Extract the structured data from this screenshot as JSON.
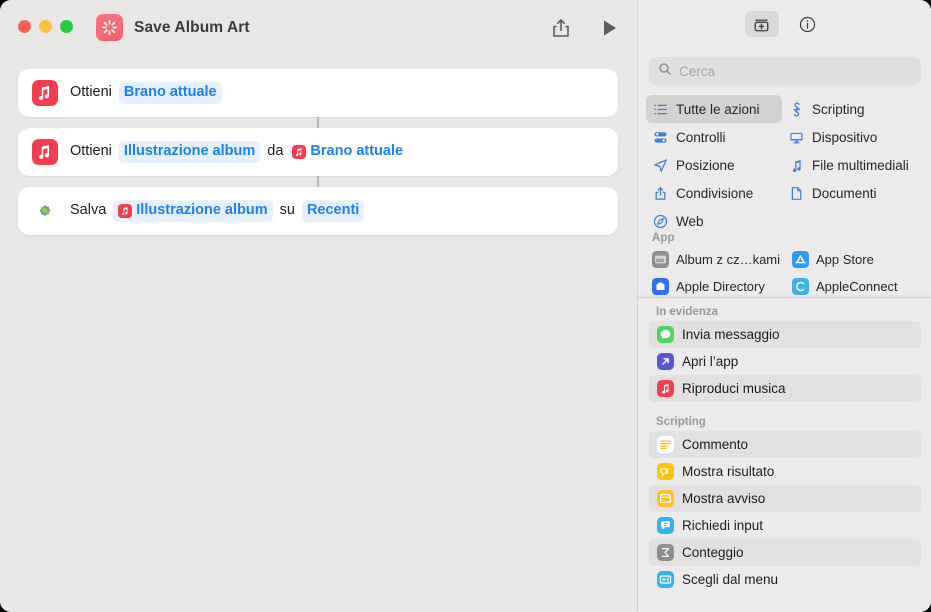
{
  "window": {
    "traffic_lights": [
      "close",
      "minimize",
      "zoom"
    ],
    "app_icon": "shortcuts-icon",
    "title": "Save Album Art",
    "share_label": "share-icon",
    "run_label": "run-icon"
  },
  "editor": {
    "actions": [
      {
        "icon": "music-app-icon",
        "icon_color": "#f43d50",
        "parts": [
          {
            "kind": "word",
            "text": "Ottieni"
          },
          {
            "kind": "token",
            "text": "Brano attuale",
            "style": "filled",
            "glyph": null
          }
        ]
      },
      {
        "icon": "music-app-icon",
        "icon_color": "#f43d50",
        "parts": [
          {
            "kind": "word",
            "text": "Ottieni"
          },
          {
            "kind": "token",
            "text": "Illustrazione album",
            "style": "filled",
            "glyph": null
          },
          {
            "kind": "word",
            "text": "da"
          },
          {
            "kind": "token",
            "text": "Brano attuale",
            "style": "plain",
            "glyph": "music-variable-icon"
          }
        ]
      },
      {
        "icon": "photos-app-icon",
        "icon_color": "#ffffff",
        "parts": [
          {
            "kind": "word",
            "text": "Salva"
          },
          {
            "kind": "token",
            "text": "Illustrazione album",
            "style": "filled",
            "glyph": "music-variable-icon"
          },
          {
            "kind": "word",
            "text": "su"
          },
          {
            "kind": "token",
            "text": "Recenti",
            "style": "filled",
            "glyph": null
          }
        ]
      }
    ]
  },
  "sidebar": {
    "toolbar": [
      {
        "name": "action-library-icon",
        "active": true
      },
      {
        "name": "info-icon",
        "active": false
      }
    ],
    "search": {
      "icon": "search-icon",
      "placeholder": "Cerca",
      "value": ""
    },
    "categories": [
      {
        "label": "Tutte le azioni",
        "icon": "list-icon",
        "selected": true
      },
      {
        "label": "Scripting",
        "icon": "scripting-icon",
        "selected": false
      },
      {
        "label": "Controlli",
        "icon": "controls-icon",
        "selected": false
      },
      {
        "label": "Dispositivo",
        "icon": "device-icon",
        "selected": false
      },
      {
        "label": "Posizione",
        "icon": "location-icon",
        "selected": false
      },
      {
        "label": "File multimediali",
        "icon": "media-icon",
        "selected": false
      },
      {
        "label": "Condivisione",
        "icon": "share-icon",
        "selected": false
      },
      {
        "label": "Documenti",
        "icon": "document-icon",
        "selected": false
      },
      {
        "label": "Web",
        "icon": "web-icon",
        "selected": false
      }
    ],
    "app_section": {
      "title": "App",
      "items": [
        {
          "label": "Album z cz…kami",
          "icon": "album-icon"
        },
        {
          "label": "App Store",
          "icon": "appstore-icon"
        },
        {
          "label": "Apple Directory",
          "icon": "apple-directory-icon"
        },
        {
          "label": "AppleConnect",
          "icon": "appleconnect-icon"
        }
      ]
    },
    "featured": {
      "title": "In evidenza",
      "items": [
        {
          "label": "Invia messaggio",
          "icon": "messages-icon",
          "color": "#4cd662",
          "striped": true
        },
        {
          "label": "Apri l’app",
          "icon": "open-app-icon",
          "color": "#5756d6",
          "striped": false
        },
        {
          "label": "Riproduci musica",
          "icon": "music-icon",
          "color": "#f43d50",
          "striped": true
        }
      ]
    },
    "scripting": {
      "title": "Scripting",
      "items": [
        {
          "label": "Commento",
          "icon": "comment-icon",
          "color": "#ffffff",
          "striped": true
        },
        {
          "label": "Mostra risultato",
          "icon": "show-result-icon",
          "color": "#ffc219",
          "striped": false
        },
        {
          "label": "Mostra avviso",
          "icon": "show-alert-icon",
          "color": "#ffc219",
          "striped": true
        },
        {
          "label": "Richiedi input",
          "icon": "ask-input-icon",
          "color": "#34b3f1",
          "striped": false
        },
        {
          "label": "Conteggio",
          "icon": "count-icon",
          "color": "#8c8c91",
          "striped": true
        },
        {
          "label": "Scegli dal menu",
          "icon": "choose-menu-icon",
          "color": "#34b3f1",
          "striped": false
        }
      ]
    }
  },
  "colors": {
    "canvas": "#e9e6e6",
    "card": "#ffffff",
    "accent_blue": "#1b81f5",
    "token_bg": "#e6f0fe",
    "sidebar_bg": "#eceaea"
  }
}
